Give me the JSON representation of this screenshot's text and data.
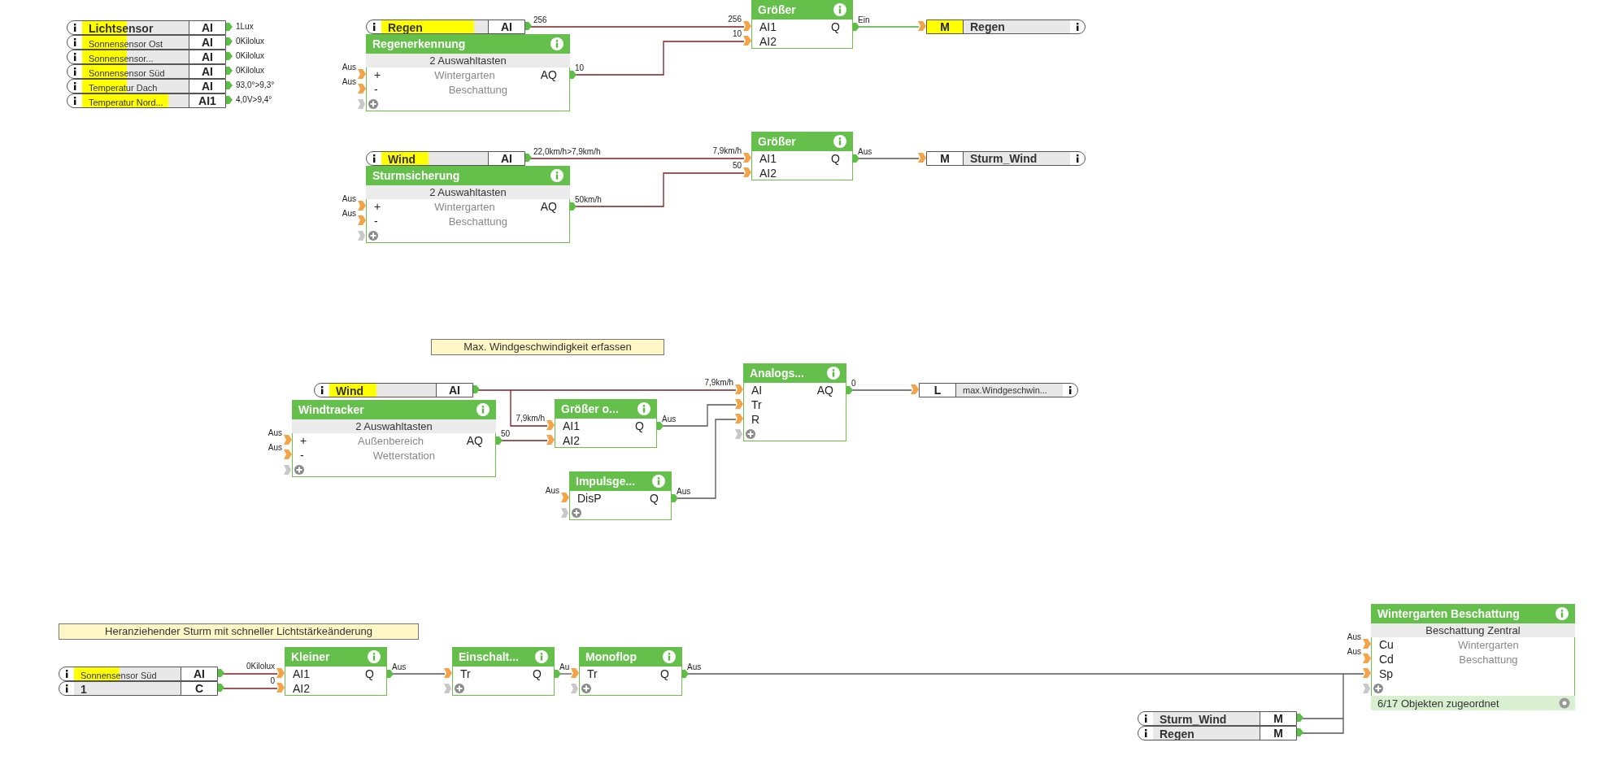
{
  "sensor_list": [
    {
      "name": "Lichtsensor",
      "type": "AI",
      "value": "1Lux",
      "level": 0.42,
      "bold": true
    },
    {
      "name": "Sonnensensor Ost",
      "type": "AI",
      "value": "0Kilolux",
      "level": 0.42,
      "bold": false
    },
    {
      "name": "Sonnensensor...",
      "type": "AI",
      "value": "0Kilolux",
      "level": 0.42,
      "bold": false
    },
    {
      "name": "Sonnensensor Süd",
      "type": "AI",
      "value": "0Kilolux",
      "level": 0.42,
      "bold": false
    },
    {
      "name": "Temperatur Dach",
      "type": "AI",
      "value": "93,0°>9,3°",
      "level": 0.42,
      "bold": false
    },
    {
      "name": "Temperatur Nord...",
      "type": "AI1",
      "value": "4,0V>9,4°",
      "level": 0.81,
      "bold": false
    }
  ],
  "inputs": [
    {
      "name": "Regen",
      "type": "AI",
      "value": "256",
      "level": 0.87,
      "bold": true
    },
    {
      "name": "Wind",
      "type": "AI",
      "value": "22,0km/h>7,9km/h",
      "level": 0.44,
      "bold": true
    },
    {
      "name": "Wind",
      "type": "AI",
      "level": 0.44,
      "bold": true
    },
    {
      "name": "Sonnensensor Süd",
      "type": "AI",
      "level": 0.43,
      "bold": false
    },
    {
      "name": "1",
      "type": "C",
      "bold": true
    },
    {
      "name": "Sturm_Wind",
      "type": "M",
      "bold": true
    },
    {
      "name": "Regen",
      "type": "M",
      "bold": true
    }
  ],
  "outputs": [
    {
      "name": "Regen",
      "type": "M",
      "highlighted": true,
      "bold": true
    },
    {
      "name": "Sturm_Wind",
      "type": "M",
      "highlighted": false,
      "bold": true
    },
    {
      "name": "max.Windgeschwin...",
      "type": "L",
      "highlighted": false,
      "bold": false
    }
  ],
  "comments": [
    "Max. Windgeschwindigkeit erfassen",
    "Heranziehender Sturm mit schneller Lichtstärkeänderung"
  ],
  "blocks": [
    {
      "title": "Regenerkennung",
      "subtitle": "2 Auswahltasten",
      "expandable": true,
      "ports": [
        {
          "in": "+",
          "in_value": "Aus",
          "text": "Wintergarten",
          "out": "AQ",
          "out_value": "10"
        },
        {
          "in": "-",
          "in_value": "Aus",
          "text": "Beschattung"
        }
      ]
    },
    {
      "title": "Größer",
      "expandable": false,
      "ports": [
        {
          "in": "AI1",
          "in_value": "256",
          "out": "Q",
          "out_value": "Ein"
        },
        {
          "in": "AI2",
          "in_value": "10"
        }
      ]
    },
    {
      "title": "Sturmsicherung",
      "subtitle": "2 Auswahltasten",
      "expandable": true,
      "ports": [
        {
          "in": "+",
          "in_value": "Aus",
          "text": "Wintergarten",
          "out": "AQ",
          "out_value": "50km/h"
        },
        {
          "in": "-",
          "in_value": "Aus",
          "text": "Beschattung"
        }
      ]
    },
    {
      "title": "Größer",
      "expandable": false,
      "ports": [
        {
          "in": "AI1",
          "in_value": "7,9km/h",
          "out": "Q",
          "out_value": "Aus"
        },
        {
          "in": "AI2",
          "in_value": "50"
        }
      ]
    },
    {
      "title": "Windtracker",
      "subtitle": "2 Auswahltasten",
      "expandable": true,
      "ports": [
        {
          "in": "+",
          "in_value": "Aus",
          "text": "Außenbereich",
          "out": "AQ",
          "out_value": "50"
        },
        {
          "in": "-",
          "in_value": "Aus",
          "text": "Wetterstation"
        }
      ]
    },
    {
      "title": "Größer o...",
      "expandable": false,
      "ports": [
        {
          "in": "AI1",
          "in_value": "7,9km/h",
          "out": "Q",
          "out_value": "Aus"
        },
        {
          "in": "AI2"
        }
      ]
    },
    {
      "title": "Impulsge...",
      "expandable": true,
      "ports": [
        {
          "in": "DisP",
          "in_value": "Aus",
          "out": "Q",
          "out_value": "Aus"
        }
      ]
    },
    {
      "title": "Analogs...",
      "expandable": true,
      "ports": [
        {
          "in": "AI",
          "in_value": "7,9km/h",
          "out": "AQ",
          "out_value": "0"
        },
        {
          "in": "Tr"
        },
        {
          "in": "R"
        }
      ]
    },
    {
      "title": "Kleiner",
      "expandable": false,
      "ports": [
        {
          "in": "AI1",
          "in_value": "0Kilolux",
          "out": "Q",
          "out_value": "Aus"
        },
        {
          "in": "AI2",
          "in_value": "0"
        }
      ]
    },
    {
      "title": "Einschalt...",
      "expandable": true,
      "ports": [
        {
          "in": "Tr",
          "out": "Q",
          "out_value": "Au"
        }
      ]
    },
    {
      "title": "Monoflop",
      "expandable": true,
      "ports": [
        {
          "in": "Tr",
          "out": "Q",
          "out_value": "Aus"
        }
      ]
    },
    {
      "title": "Wintergarten Beschattung",
      "subtitle": "Beschattung Zentral",
      "expandable": true,
      "footer": "6/17 Objekten zugeordnet",
      "ports": [
        {
          "in": "Cu",
          "in_value": "Aus",
          "text": "Wintergarten"
        },
        {
          "in": "Cd",
          "in_value": "Aus",
          "text": "Beschattung"
        },
        {
          "in": "Sp"
        }
      ]
    }
  ]
}
